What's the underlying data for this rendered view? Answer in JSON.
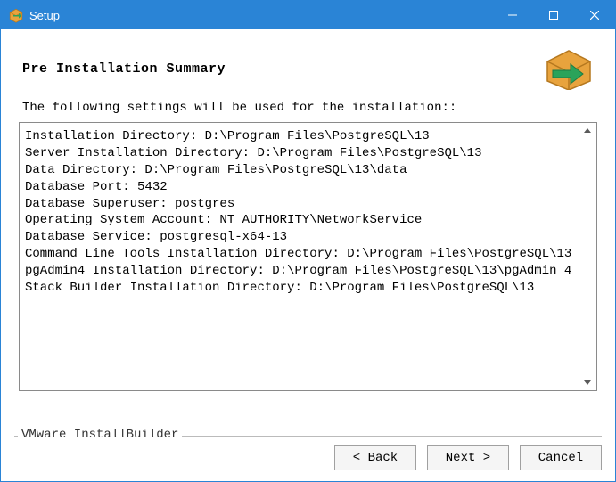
{
  "window": {
    "title": "Setup"
  },
  "page": {
    "heading": "Pre Installation Summary",
    "intro": "The following settings will be used for the installation::",
    "brand": "VMware InstallBuilder"
  },
  "summary_lines": [
    "Installation Directory: D:\\Program Files\\PostgreSQL\\13",
    "Server Installation Directory: D:\\Program Files\\PostgreSQL\\13",
    "Data Directory: D:\\Program Files\\PostgreSQL\\13\\data",
    "Database Port: 5432",
    "Database Superuser: postgres",
    "Operating System Account: NT AUTHORITY\\NetworkService",
    "Database Service: postgresql-x64-13",
    "Command Line Tools Installation Directory: D:\\Program Files\\PostgreSQL\\13",
    "pgAdmin4 Installation Directory: D:\\Program Files\\PostgreSQL\\13\\pgAdmin 4",
    "Stack Builder Installation Directory: D:\\Program Files\\PostgreSQL\\13"
  ],
  "buttons": {
    "back": "< Back",
    "next": "Next >",
    "cancel": "Cancel"
  }
}
